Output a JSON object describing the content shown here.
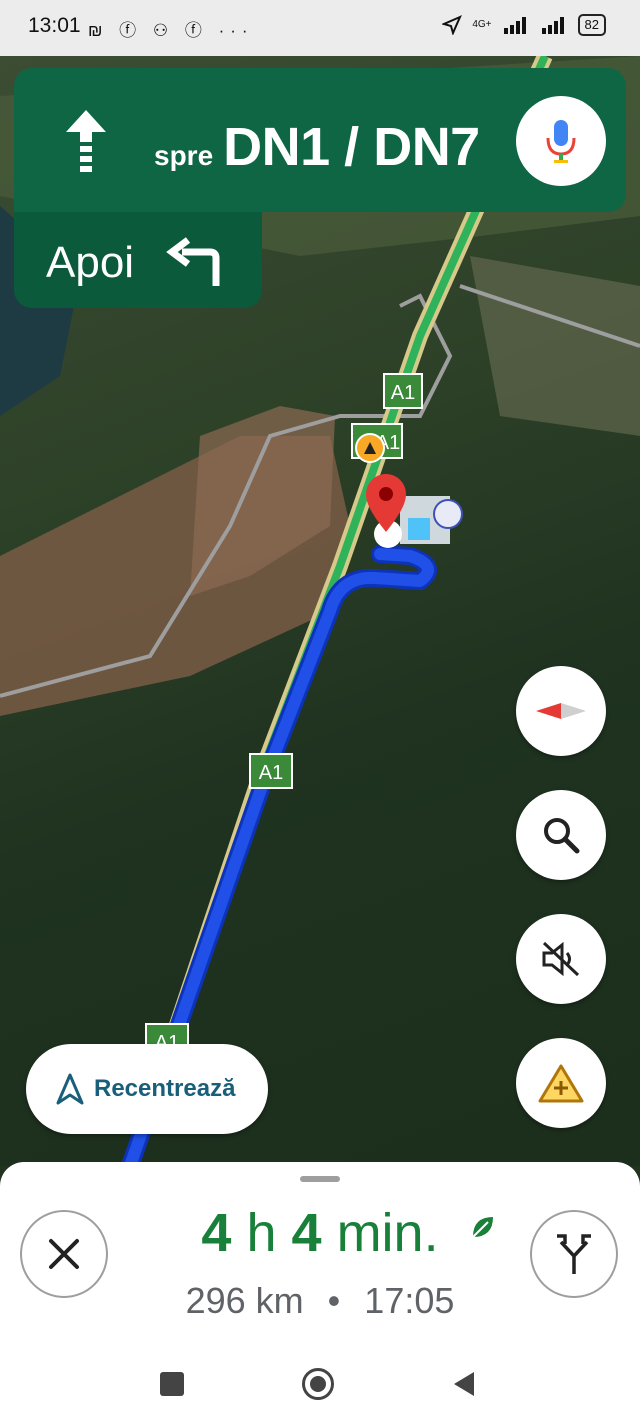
{
  "status_bar": {
    "time": "13:01",
    "left_icons": "₪ ⓕ ⚇ ⓕ ···",
    "network": "4G+",
    "battery": "82"
  },
  "nav_banner": {
    "direction_icon": "straight-arrow-icon",
    "prefix": "spre",
    "destination": "DN1 / DN7",
    "bg_color": "#0f6644"
  },
  "next_step": {
    "label": "Apoi",
    "icon": "turn-left-icon"
  },
  "map": {
    "road_labels": [
      "A1",
      "A1",
      "A1",
      "A1"
    ],
    "route_color": "#2050e8"
  },
  "controls": {
    "compass_icon": "compass-icon",
    "search_icon": "search-icon",
    "mute_icon": "volume-off-icon",
    "report_icon": "report-incident-icon"
  },
  "recenter": {
    "label": "Recentrează",
    "icon": "navigation-arrow-icon"
  },
  "trip": {
    "duration_h": "4",
    "h_unit": "h",
    "duration_min": "4",
    "min_unit": "min.",
    "distance": "296 km",
    "separator": "•",
    "arrival": "17:05",
    "eta_color": "#188038"
  },
  "bottom_nav": {
    "recent_icon": "square-icon",
    "home_icon": "circle-icon",
    "back_icon": "triangle-back-icon"
  }
}
